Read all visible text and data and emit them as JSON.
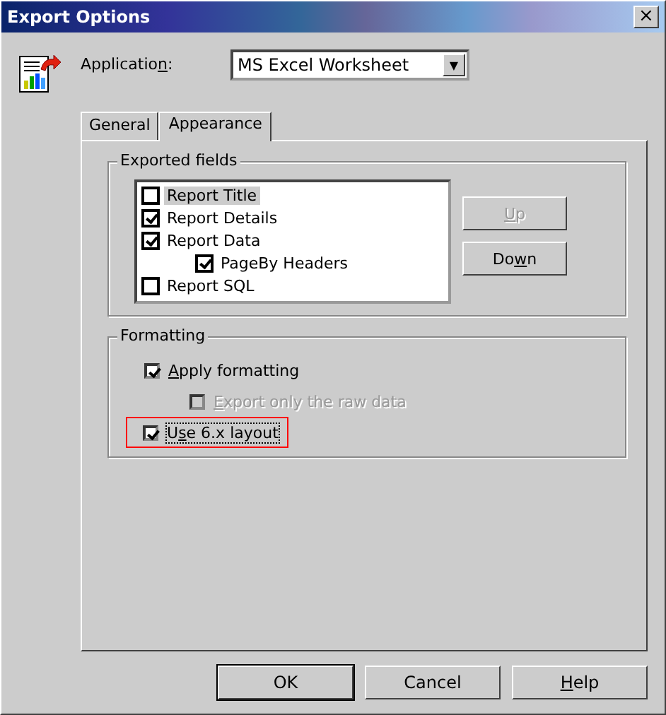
{
  "window": {
    "title": "Export Options",
    "close": "×"
  },
  "application": {
    "label": {
      "pre": "Applicatio",
      "key": "n",
      "post": ":"
    },
    "value": "MS Excel Worksheet",
    "arrow": "▼"
  },
  "tabs": [
    {
      "label": "General",
      "selected": false
    },
    {
      "label": "Appearance",
      "selected": true
    }
  ],
  "exported_fields": {
    "title": "Exported fields",
    "items": [
      {
        "label": "Report Title",
        "checked": false,
        "selected": true
      },
      {
        "label": "Report Details",
        "checked": true,
        "selected": false
      },
      {
        "label": "Report Data",
        "checked": true,
        "selected": false,
        "children": [
          {
            "label": "PageBy Headers",
            "checked": true,
            "selected": false
          }
        ]
      },
      {
        "label": "Report SQL",
        "checked": false,
        "selected": false
      }
    ],
    "buttons": [
      {
        "label": {
          "key": "U",
          "post": "p"
        },
        "disabled": true
      },
      {
        "label": {
          "pre": "Do",
          "key": "w",
          "post": "n"
        },
        "disabled": false
      }
    ]
  },
  "formatting": {
    "title": "Formatting",
    "options": [
      {
        "label": {
          "key": "A",
          "post": "pply formatting"
        },
        "checked": true,
        "disabled": false,
        "indented": false,
        "highlighted": false,
        "focused": false
      },
      {
        "label": {
          "key": "E",
          "post": "xport only the raw data"
        },
        "checked": false,
        "disabled": true,
        "indented": true,
        "highlighted": false,
        "focused": false
      },
      {
        "label": {
          "pre": "U",
          "key": "s",
          "post": "e 6.x layout"
        },
        "checked": true,
        "disabled": false,
        "indented": false,
        "highlighted": true,
        "focused": true
      }
    ]
  },
  "buttons": [
    {
      "label": {
        "pre": "OK"
      },
      "default": true
    },
    {
      "label": {
        "pre": "Cancel"
      },
      "default": false
    },
    {
      "label": {
        "key": "H",
        "post": "elp"
      },
      "default": false
    }
  ]
}
